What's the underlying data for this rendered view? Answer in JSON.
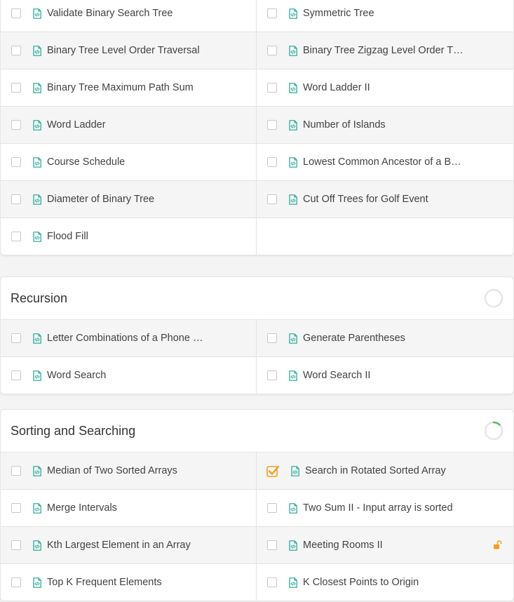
{
  "trees": {
    "rows": [
      [
        "Validate Binary Search Tree",
        "Symmetric Tree"
      ],
      [
        "Binary Tree Level Order Traversal",
        "Binary Tree Zigzag Level Order T…"
      ],
      [
        "Binary Tree Maximum Path Sum",
        "Word Ladder II"
      ],
      [
        "Word Ladder",
        "Number of Islands"
      ],
      [
        "Course Schedule",
        "Lowest Common Ancestor of a B…"
      ],
      [
        "Diameter of Binary Tree",
        "Cut Off Trees for Golf Event"
      ],
      [
        "Flood Fill",
        ""
      ]
    ]
  },
  "recursion": {
    "title": "Recursion",
    "progress": 0,
    "rows": [
      [
        "Letter Combinations of a Phone …",
        "Generate Parentheses"
      ],
      [
        "Word Search",
        "Word Search II"
      ]
    ]
  },
  "sorting": {
    "title": "Sorting and Searching",
    "progress": 0.125,
    "rows": [
      [
        "Median of Two Sorted Arrays",
        "Search in Rotated Sorted Array"
      ],
      [
        "Merge Intervals",
        "Two Sum II - Input array is sorted"
      ],
      [
        "Kth Largest Element in an Array",
        "Meeting Rooms II"
      ],
      [
        "Top K Frequent Elements",
        "K Closest Points to Origin"
      ]
    ],
    "checked": [
      "Search in Rotated Sorted Array"
    ],
    "unlocked": [
      "Meeting Rooms II"
    ]
  },
  "colors": {
    "accent_orange": "#f0a020",
    "doc_icon": "#1fa594",
    "progress_green": "#5cb85c",
    "progress_track": "#e6e6e6"
  },
  "icons": {
    "problem": "code-file-icon",
    "checkbox": "checkbox-icon",
    "check": "checked-checkbox-icon",
    "lock": "unlocked-lock-icon",
    "progress": "progress-ring-icon"
  }
}
